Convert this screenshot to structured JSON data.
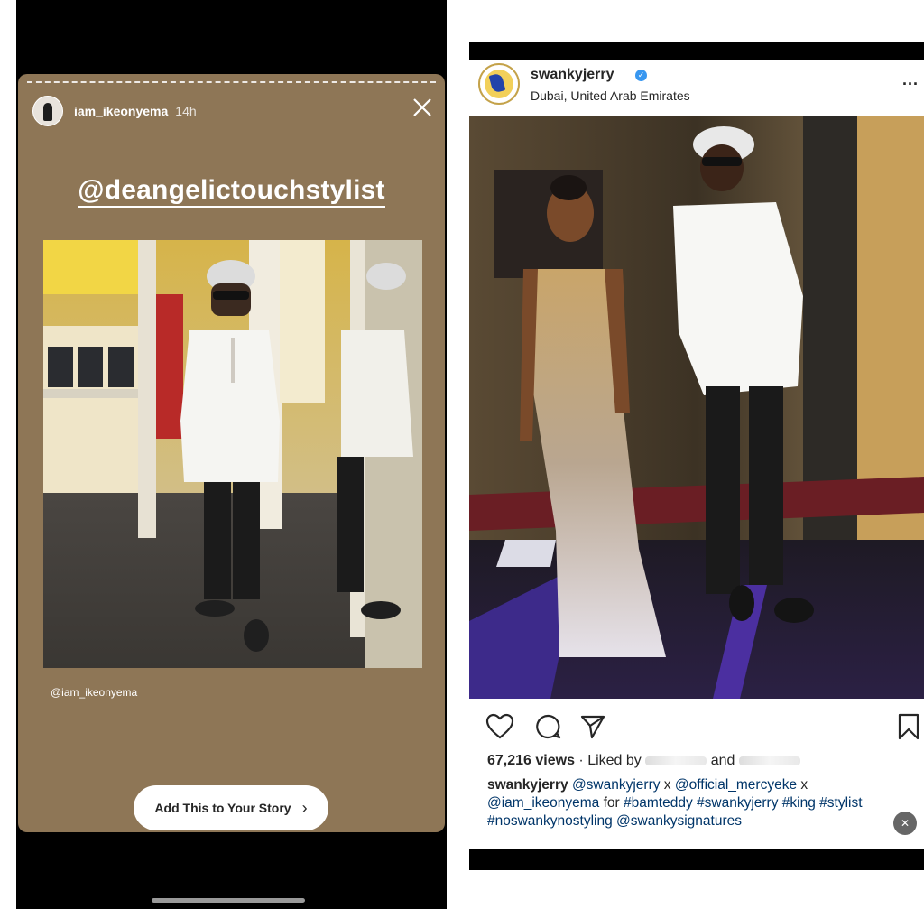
{
  "story": {
    "username": "iam_ikeonyema",
    "time": "14h",
    "mention": "@deangelictouchstylist",
    "photo_credit": "@iam_ikeonyema",
    "add_button_label": "Add This to Your Story",
    "chevron": "›",
    "background_color": "#8e7656",
    "icons": [
      "close-icon",
      "chevron-right-icon"
    ]
  },
  "post": {
    "username": "swankyjerry",
    "verified_mark": "✓",
    "location": "Dubai, United Arab Emirates",
    "more": "...",
    "views": "67,216 views",
    "liked_by_prefix": " · Liked by",
    "liked_by_and": "and",
    "caption_segments": [
      {
        "text": "swankyjerry",
        "kind": "user"
      },
      {
        "text": " ",
        "kind": "plain"
      },
      {
        "text": "@swankyjerry",
        "kind": "tag"
      },
      {
        "text": " x ",
        "kind": "plain"
      },
      {
        "text": "@official_mercyeke",
        "kind": "tag"
      },
      {
        "text": " x ",
        "kind": "plain"
      },
      {
        "text": "@iam_ikeonyema",
        "kind": "tag"
      },
      {
        "text": " for ",
        "kind": "plain"
      },
      {
        "text": "#bamteddy",
        "kind": "tag"
      },
      {
        "text": " ",
        "kind": "plain"
      },
      {
        "text": "#swankyjerry",
        "kind": "tag"
      },
      {
        "text": " ",
        "kind": "plain"
      },
      {
        "text": "#king",
        "kind": "tag"
      },
      {
        "text": " ",
        "kind": "plain"
      },
      {
        "text": "#stylist",
        "kind": "tag"
      },
      {
        "text": " ",
        "kind": "plain"
      },
      {
        "text": "#noswankynostyling",
        "kind": "tag"
      },
      {
        "text": " ",
        "kind": "plain"
      },
      {
        "text": "@swankysignatures",
        "kind": "tag"
      }
    ],
    "icons": [
      "heart-icon",
      "comment-icon",
      "share-icon",
      "bookmark-icon",
      "mute-icon",
      "verified-icon",
      "more-icon"
    ]
  }
}
